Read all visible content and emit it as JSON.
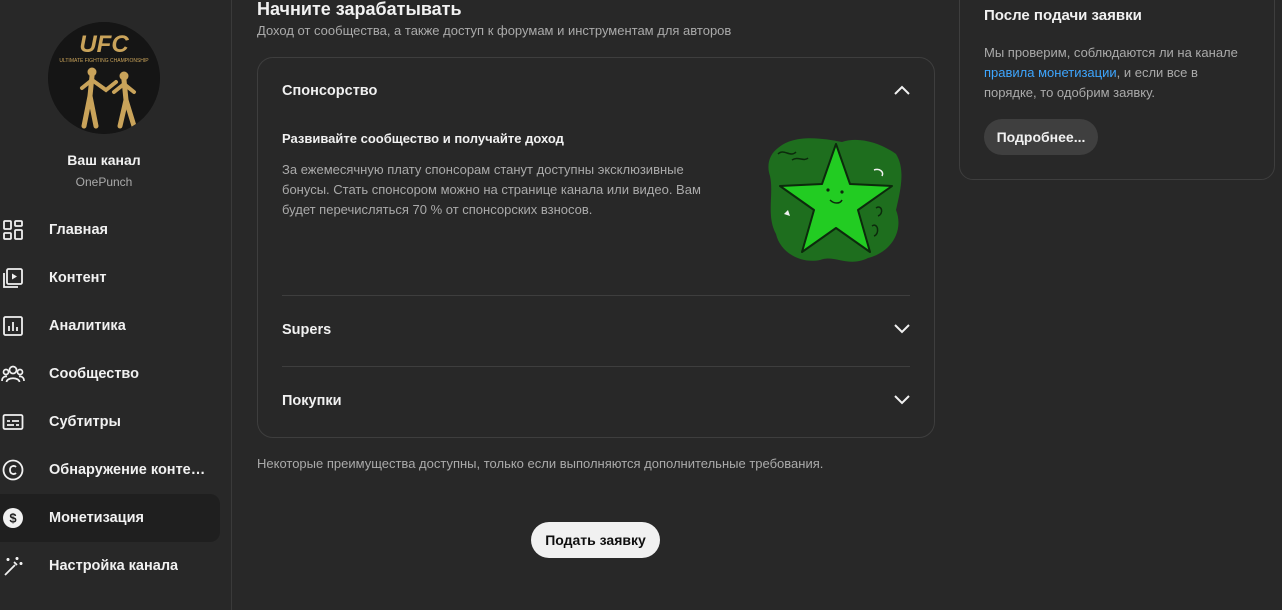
{
  "sidebar": {
    "avatar_text": "UFC",
    "avatar_subtext": "ULTIMATE FIGHTING CHAMPIONSHIP",
    "channel_title": "Ваш канал",
    "channel_handle": "OnePunch",
    "items": [
      {
        "label": "Главная",
        "icon": "dashboard-icon"
      },
      {
        "label": "Контент",
        "icon": "content-icon"
      },
      {
        "label": "Аналитика",
        "icon": "analytics-icon"
      },
      {
        "label": "Сообщество",
        "icon": "community-icon"
      },
      {
        "label": "Субтитры",
        "icon": "subtitles-icon"
      },
      {
        "label": "Обнаружение контента",
        "icon": "copyright-icon"
      },
      {
        "label": "Монетизация",
        "icon": "monetization-icon",
        "active": true
      },
      {
        "label": "Настройка канала",
        "icon": "customization-icon"
      }
    ]
  },
  "main": {
    "title": "Начните зарабатывать",
    "subtitle": "Доход от сообщества, а также доступ к форумам и инструментам для авторов",
    "sections": [
      {
        "label": "Спонсорство",
        "expanded": true
      },
      {
        "label": "Supers",
        "expanded": false
      },
      {
        "label": "Покупки",
        "expanded": false
      }
    ],
    "sponsorship": {
      "heading": "Развивайте сообщество и получайте доход",
      "body": "За ежемесячную плату спонсорам станут доступны эксклюзивные бонусы. Стать спонсором можно на странице канала или видео. Вам будет перечисляться 70 % от спонсорских взносов."
    },
    "note": "Некоторые преимущества доступны, только если выполняются дополнительные требования.",
    "apply_button": "Подать заявку"
  },
  "side_panel": {
    "title": "После подачи заявки",
    "text_before": "Мы проверим, соблюдаются ли на канале ",
    "link": "правила монетизации",
    "text_after": ", и если все в порядке, то одобрим заявку.",
    "button": "Подробнее..."
  },
  "colors": {
    "background": "#282828",
    "accent_link": "#3ea6ff",
    "star_green": "#22cc22",
    "avatar_gold": "#c9a35a"
  }
}
